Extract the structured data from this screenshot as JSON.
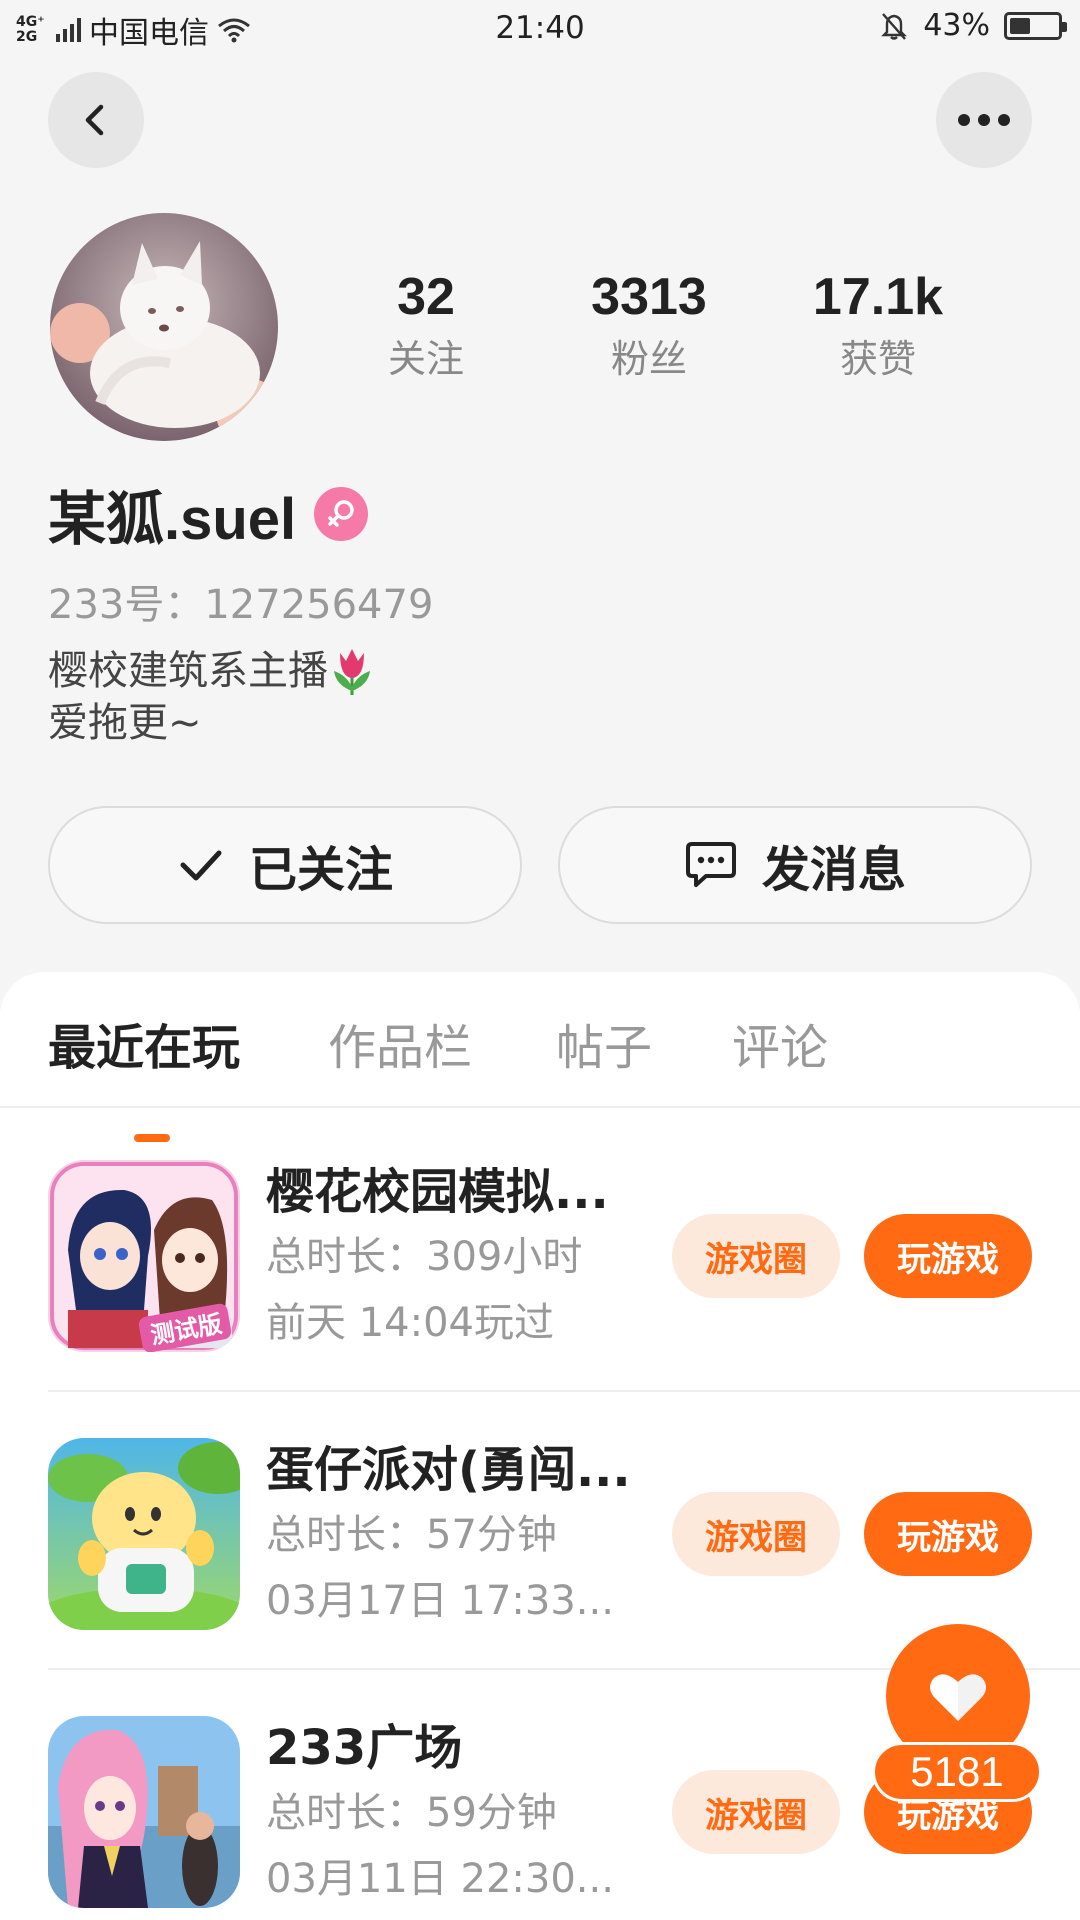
{
  "status_bar": {
    "network_top": "4G⁺",
    "network_bottom": "2G",
    "carrier": "中国电信",
    "time": "21:40",
    "battery_percent": "43%",
    "battery_level": 0.43
  },
  "nav": {
    "back_icon": "chevron-left-icon",
    "more_icon": "more-dots-icon"
  },
  "profile": {
    "stats": [
      {
        "value": "32",
        "label": "关注"
      },
      {
        "value": "3313",
        "label": "粉丝"
      },
      {
        "value": "17.1k",
        "label": "获赞"
      }
    ],
    "username": "某狐.suel",
    "gender_icon": "female-icon",
    "gender_color": "#f57aa8",
    "uid": "233号：127256479",
    "bio_lines": [
      "樱校建筑系主播",
      "爱拖更~"
    ],
    "follow_button": "已关注",
    "message_button": "发消息"
  },
  "tabs": [
    {
      "label": "最近在玩",
      "active": true
    },
    {
      "label": "作品栏",
      "active": false
    },
    {
      "label": "帖子",
      "active": false
    },
    {
      "label": "评论",
      "active": false
    }
  ],
  "games": [
    {
      "title": "樱花校园模拟...",
      "duration": "总时长：309小时",
      "last_played": "前天 14:04玩过",
      "icon_badge": "测试版",
      "circle_label": "游戏圈",
      "play_label": "玩游戏"
    },
    {
      "title": "蛋仔派对(勇闯...",
      "duration": "总时长：57分钟",
      "last_played": "03月17日 17:33...",
      "circle_label": "游戏圈",
      "play_label": "玩游戏"
    },
    {
      "title": "233广场",
      "duration": "总时长：59分钟",
      "last_played": "03月11日 22:30...",
      "circle_label": "游戏圈",
      "play_label": "玩游戏"
    }
  ],
  "floating_like": {
    "icon": "heart-icon",
    "count": "5181"
  },
  "colors": {
    "accent": "#ff6a13",
    "accent_light": "#fde9dc",
    "background": "#f5f5f5"
  }
}
